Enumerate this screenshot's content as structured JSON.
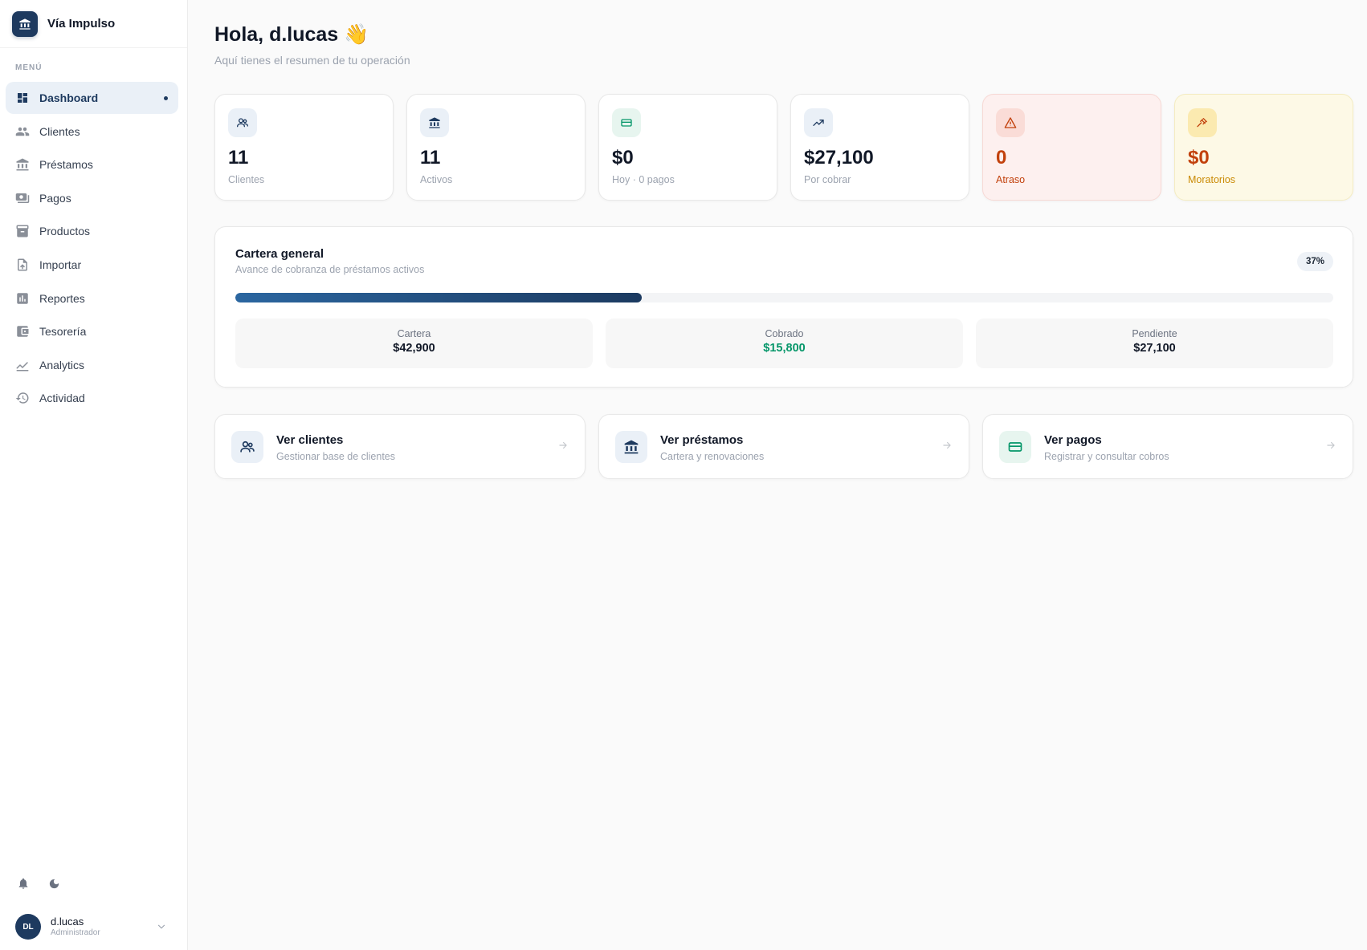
{
  "brand": {
    "name": "Vía Impulso",
    "icon": "bank-icon"
  },
  "sidebar": {
    "menu_title": "MENÚ",
    "items": [
      {
        "label": "Dashboard",
        "icon": "dashboard-icon",
        "active": true
      },
      {
        "label": "Clientes",
        "icon": "users-icon"
      },
      {
        "label": "Préstamos",
        "icon": "bank-icon"
      },
      {
        "label": "Pagos",
        "icon": "payments-icon"
      },
      {
        "label": "Productos",
        "icon": "archive-icon"
      },
      {
        "label": "Importar",
        "icon": "file-upload-icon"
      },
      {
        "label": "Reportes",
        "icon": "bar-chart-icon"
      },
      {
        "label": "Tesorería",
        "icon": "wallet-icon"
      },
      {
        "label": "Analytics",
        "icon": "analytics-icon"
      },
      {
        "label": "Actividad",
        "icon": "history-icon"
      }
    ]
  },
  "user": {
    "initials": "DL",
    "name": "d.lucas",
    "role": "Administrador"
  },
  "header": {
    "greeting": "Hola, d.lucas 👋",
    "subtitle": "Aquí tienes el resumen de tu operación"
  },
  "stats": [
    {
      "value": "11",
      "label": "Clientes",
      "icon": "users-icon"
    },
    {
      "value": "11",
      "label": "Activos",
      "icon": "bank-icon"
    },
    {
      "value": "$0",
      "label": "Hoy · 0 pagos",
      "icon": "cash-icon"
    },
    {
      "value": "$27,100",
      "label": "Por cobrar",
      "icon": "trending-up-icon"
    },
    {
      "value": "0",
      "label": "Atraso",
      "icon": "warning-icon"
    },
    {
      "value": "$0",
      "label": "Moratorios",
      "icon": "gavel-icon"
    }
  ],
  "cartera": {
    "title": "Cartera general",
    "subtitle": "Avance de cobranza de préstamos activos",
    "percent_label": "37%",
    "progress_fraction": 0.37,
    "boxes": [
      {
        "label": "Cartera",
        "value": "$42,900"
      },
      {
        "label": "Cobrado",
        "value": "$15,800"
      },
      {
        "label": "Pendiente",
        "value": "$27,100"
      }
    ]
  },
  "actions": [
    {
      "title": "Ver clientes",
      "subtitle": "Gestionar base de clientes",
      "icon": "users-icon"
    },
    {
      "title": "Ver préstamos",
      "subtitle": "Cartera y renovaciones",
      "icon": "bank-icon"
    },
    {
      "title": "Ver pagos",
      "subtitle": "Registrar y consultar cobros",
      "icon": "cash-icon"
    }
  ],
  "colors": {
    "primary": "#1e3a5f",
    "success": "#059669",
    "danger": "#c2410c",
    "warning": "#ca8a04"
  }
}
